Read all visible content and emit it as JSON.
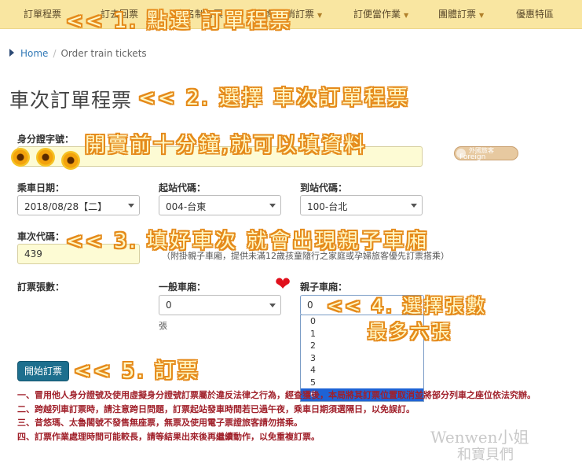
{
  "nav": {
    "items": [
      {
        "label": "訂單程票",
        "caret": false
      },
      {
        "label": "訂去回票",
        "caret": false
      },
      {
        "label": "實名制訂票",
        "caret": false
      },
      {
        "label": "查詢/取消訂票",
        "caret": true
      },
      {
        "label": "訂便當作業",
        "caret": true
      },
      {
        "label": "團體訂票",
        "caret": true
      },
      {
        "label": "優惠特區",
        "caret": false
      }
    ]
  },
  "breadcrumb": {
    "home": "Home",
    "separator": "/",
    "current": "Order train tickets"
  },
  "page_title": "車次訂單程票",
  "form": {
    "id_label": "身分證字號：",
    "id_value": "",
    "foreign_toggle_line1": "外國旅客",
    "foreign_toggle_line2": "Foreign passenger",
    "date_label": "乘車日期：",
    "date_value": "2018/08/28【二】",
    "from_label": "起站代碼：",
    "from_value": "004-台東",
    "to_label": "到站代碼：",
    "to_value": "100-台北",
    "train_label": "車次代碼：",
    "train_value": "439",
    "train_hint": "（附掛親子車廂，提供未滿12歲孩童隨行之家庭或孕婦旅客優先訂票搭乘）",
    "tickets_label": "訂票張數：",
    "normal_car_label": "一般車廂：",
    "normal_car_value": "0",
    "unit_label": "張",
    "family_car_label": "親子車廂：",
    "family_car_value": "0",
    "family_car_options": [
      "0",
      "1",
      "2",
      "3",
      "4",
      "5",
      "6"
    ],
    "family_car_highlighted": "6",
    "submit_label": "開始訂票"
  },
  "notices": [
    "一、冒用他人身分證號及使用虛擬身分證號訂票屬於違反法律之行為，經查獲後，本局將其訂票位置取消並將部分列車之座位依法究辦。",
    "二、跨越列車訂票時，請注意跨日問題，訂票起站發車時間若已過午夜，乘車日期須選隔日，以免誤訂。",
    "三、昔悠瑪、太魯閣號不發售無座票，無票及使用電子票證旅客請勿搭乘。",
    "四、訂票作業處理時間可能較長，請等結果出來後再繼續動作，以免重複訂票。"
  ],
  "annotations": {
    "step1": "<< 1. 點選 訂單程票",
    "step2": "<< 2. 選擇 車次訂單程票",
    "presale": "開賣前十分鐘,就可以填資料",
    "step3": "<< 3. 填好車次 就會出現親子車廂",
    "step4_line1": "<< 4. 選擇張數",
    "step4_line2": "最多六張",
    "step5": "<< 5. 訂票"
  },
  "watermark": {
    "line1": "Wenwen小姐",
    "line2": "和寶貝們"
  },
  "colors": {
    "navbar": "#f9e6a1",
    "annotation_outline": "#e58a1a",
    "annotation_fill": "#fff7c4",
    "notice_text": "#a0202a",
    "submit_button": "#1d6f8e"
  }
}
